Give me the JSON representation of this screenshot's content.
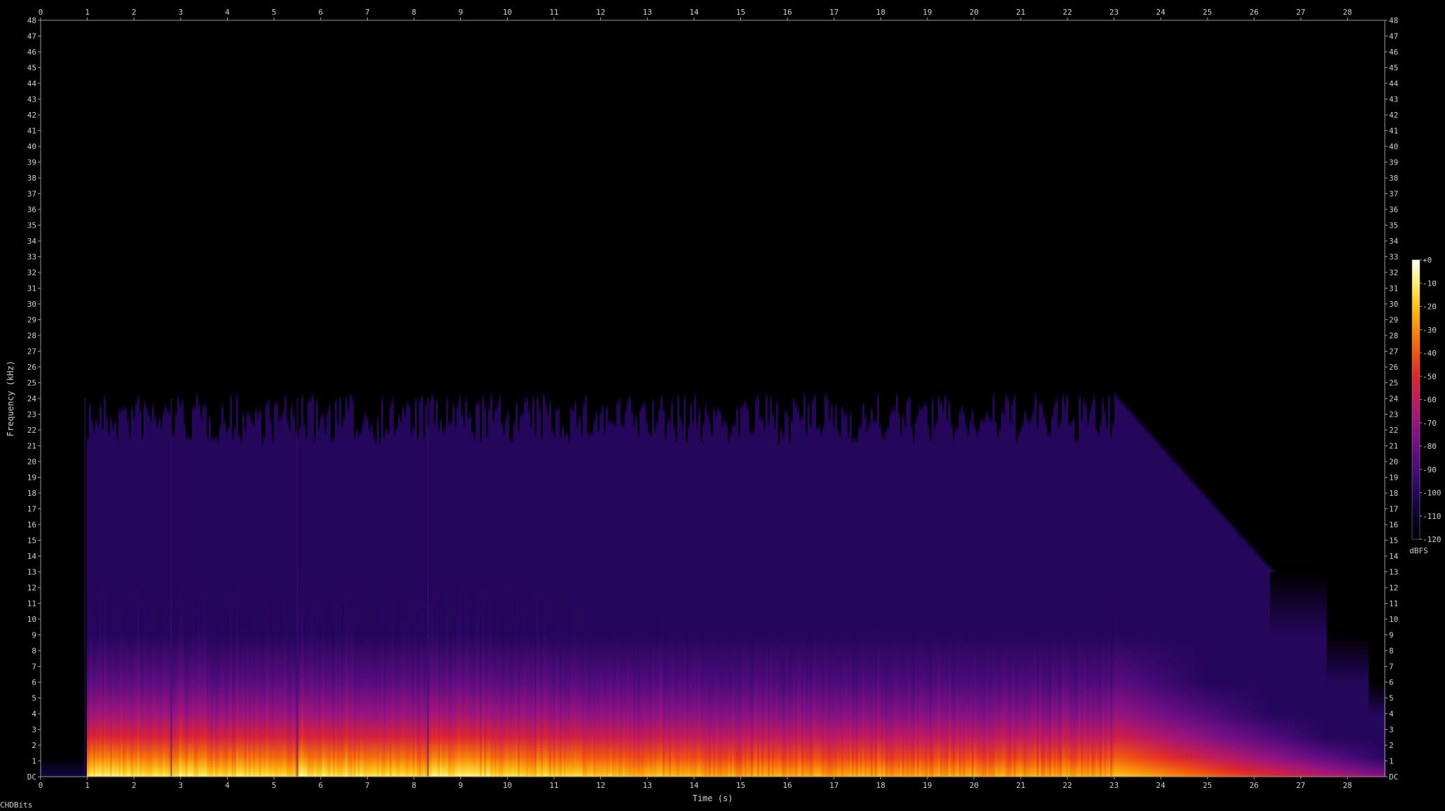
{
  "chart_data": {
    "type": "heatmap",
    "subtype": "spectrogram",
    "xlabel": "Time (s)",
    "ylabel": "Frequency (kHz)",
    "xlim": [
      0,
      28.8
    ],
    "ylim": [
      0,
      48
    ],
    "x_ticks": [
      0,
      1,
      2,
      3,
      4,
      5,
      6,
      7,
      8,
      9,
      10,
      11,
      12,
      13,
      14,
      15,
      16,
      17,
      18,
      19,
      20,
      21,
      22,
      23,
      24,
      25,
      26,
      27,
      28
    ],
    "y_ticks": [
      "DC",
      "1",
      "2",
      "3",
      "4",
      "5",
      "6",
      "7",
      "8",
      "9",
      "10",
      "11",
      "12",
      "13",
      "14",
      "15",
      "16",
      "17",
      "18",
      "19",
      "20",
      "21",
      "22",
      "23",
      "24",
      "25",
      "26",
      "27",
      "28",
      "29",
      "30",
      "31",
      "32",
      "33",
      "34",
      "35",
      "36",
      "37",
      "38",
      "39",
      "40",
      "41",
      "42",
      "43",
      "44",
      "45",
      "46",
      "47",
      "48"
    ],
    "colorbar": {
      "label": "dBFS",
      "range": [
        -120,
        0
      ],
      "ticks": [
        "+0",
        "-10",
        "-20",
        "-30",
        "-40",
        "-50",
        "-60",
        "-70",
        "-80",
        "-90",
        "-100",
        "-110",
        "-120"
      ],
      "colors": [
        "#000000",
        "#0a0530",
        "#26065e",
        "#4a0a7a",
        "#6e0f86",
        "#981480",
        "#c01a5e",
        "#e0262a",
        "#f2540e",
        "#f88a08",
        "#fcc214",
        "#fff06a",
        "#ffffff"
      ]
    },
    "bandwidth_khz": 24,
    "onsets_s": [
      0.95,
      2.8,
      5.5,
      8.3
    ],
    "decay_start_s": 23.0,
    "signal_end_s": 28.8
  },
  "footer": {
    "text": "CHDBits"
  }
}
